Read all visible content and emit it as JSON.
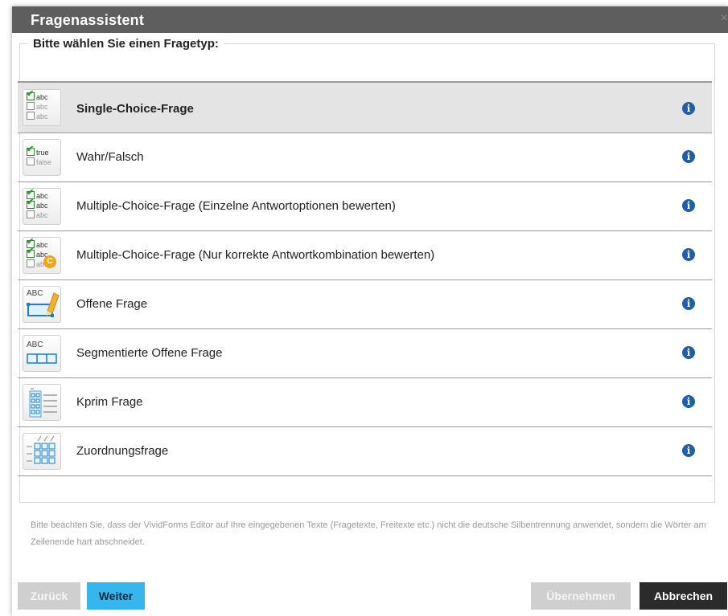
{
  "dialog": {
    "title": "Fragenassistent",
    "legend": "Bitte wählen Sie einen Fragetyp:",
    "close_glyph": "×"
  },
  "questions": [
    {
      "label": "Single-Choice-Frage",
      "icon": "single-choice-icon",
      "selected": true
    },
    {
      "label": "Wahr/Falsch",
      "icon": "true-false-icon"
    },
    {
      "label": "Multiple-Choice-Frage (Einzelne Antwortoptionen bewerten)",
      "icon": "multiple-choice-icon"
    },
    {
      "label": "Multiple-Choice-Frage (Nur korrekte Antwortkombination bewerten)",
      "icon": "multiple-choice-combination-icon"
    },
    {
      "label": "Offene Frage",
      "icon": "open-question-icon"
    },
    {
      "label": "Segmentierte Offene Frage",
      "icon": "segmented-open-question-icon"
    },
    {
      "label": "Kprim Frage",
      "icon": "kprim-icon"
    },
    {
      "label": "Zuordnungsfrage",
      "icon": "matching-question-icon"
    }
  ],
  "icon_text": {
    "abc": "abc",
    "true": "true",
    "false": "false",
    "ABC": "ABC",
    "badge": "C",
    "info": "i"
  },
  "note": "Bitte beachten Sie, dass der VividForms Editor auf Ihre eingegebenen Texte (Fragetexte, Freitexte etc.) nicht die deutsche Silbentrennung anwendet, sondern die Wörter am Zeilenende hart abschneidet.",
  "buttons": {
    "back": "Zurück",
    "next": "Weiter",
    "apply": "Übernehmen",
    "cancel": "Abbrechen"
  },
  "colors": {
    "titlebar": "#5e5e5e",
    "info_icon": "#1e5fa8",
    "next_button": "#35b6ec",
    "cancel_button": "#2b2b2b",
    "disabled_button": "#cfcfcf",
    "selected_row": "#e4e4e4"
  }
}
